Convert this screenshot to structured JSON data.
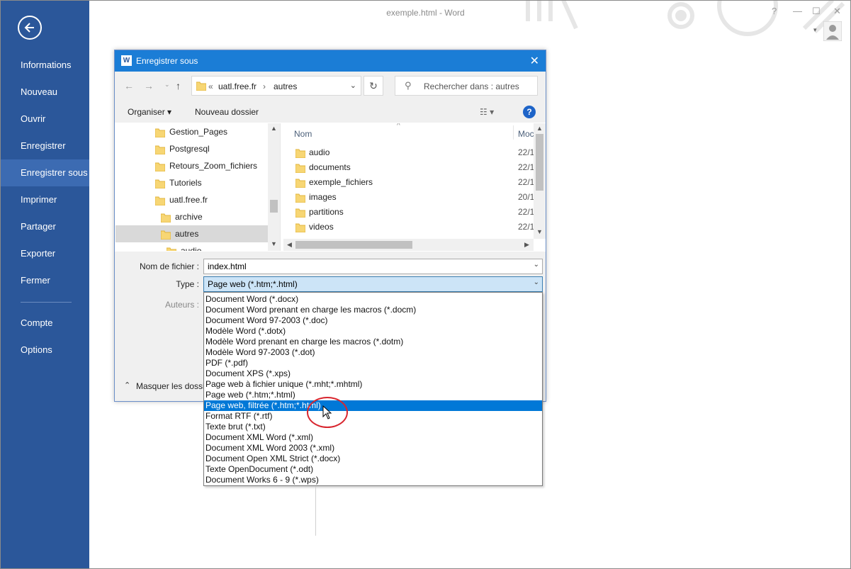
{
  "window": {
    "title": "exemple.html - Word",
    "controls": [
      "?",
      "—",
      "☐",
      "✕"
    ]
  },
  "backstage": {
    "menu": [
      "Informations",
      "Nouveau",
      "Ouvrir",
      "Enregistrer",
      "Enregistrer sous",
      "Imprimer",
      "Partager",
      "Exporter",
      "Fermer",
      "Compte",
      "Options"
    ],
    "active": "Enregistrer sous"
  },
  "dialog": {
    "title": "Enregistrer sous",
    "breadcrumb": {
      "prefix": "«",
      "parts": [
        "uatl.free.fr",
        "autres"
      ],
      "sep": "›"
    },
    "search_placeholder": "Rechercher dans : autres",
    "toolbar": {
      "organize": "Organiser ▾",
      "new_folder": "Nouveau dossier",
      "help": "?"
    },
    "tree": [
      {
        "label": "Gestion_Pages",
        "indent": 0,
        "selected": false
      },
      {
        "label": "Postgresql",
        "indent": 0,
        "selected": false
      },
      {
        "label": "Retours_Zoom_fichiers",
        "indent": 0,
        "selected": false
      },
      {
        "label": "Tutoriels",
        "indent": 0,
        "selected": false
      },
      {
        "label": "uatl.free.fr",
        "indent": 0,
        "selected": false
      },
      {
        "label": "archive",
        "indent": 1,
        "selected": false
      },
      {
        "label": "autres",
        "indent": 1,
        "selected": true
      },
      {
        "label": "audio",
        "indent": 2,
        "selected": false
      }
    ],
    "columns": {
      "name": "Nom",
      "date": "Moc"
    },
    "files": [
      {
        "name": "audio",
        "date": "22/1"
      },
      {
        "name": "documents",
        "date": "22/1"
      },
      {
        "name": "exemple_fichiers",
        "date": "22/1"
      },
      {
        "name": "images",
        "date": "20/1"
      },
      {
        "name": "partitions",
        "date": "22/1"
      },
      {
        "name": "videos",
        "date": "22/1"
      }
    ],
    "form": {
      "filename_label": "Nom de fichier :",
      "filename_value": "index.html",
      "type_label": "Type :",
      "type_value": "Page web (*.htm;*.html)",
      "authors_label": "Auteurs :",
      "hide_folders": "Masquer les dossi"
    },
    "type_options": [
      "Document Word (*.docx)",
      "Document Word prenant en charge les macros (*.docm)",
      "Document Word 97-2003 (*.doc)",
      "Modèle Word (*.dotx)",
      "Modèle Word prenant en charge les macros (*.dotm)",
      "Modèle Word 97-2003 (*.dot)",
      "PDF (*.pdf)",
      "Document XPS (*.xps)",
      "Page web à fichier unique (*.mht;*.mhtml)",
      "Page web (*.htm;*.html)",
      "Page web, filtrée (*.htm;*.html)",
      "Format RTF (*.rtf)",
      "Texte brut (*.txt)",
      "Document XML Word (*.xml)",
      "Document XML Word 2003 (*.xml)",
      "Document Open XML Strict (*.docx)",
      "Texte OpenDocument (*.odt)",
      "Document Works 6 - 9 (*.wps)"
    ],
    "highlighted_option": "Page web, filtrée (*.htm;*.html)"
  },
  "colors": {
    "backstage": "#2b579a",
    "backstage_active": "#3c6bb2",
    "dialog_title": "#1b7dd6",
    "highlight": "#0078d7",
    "annotation": "#d8262f"
  }
}
